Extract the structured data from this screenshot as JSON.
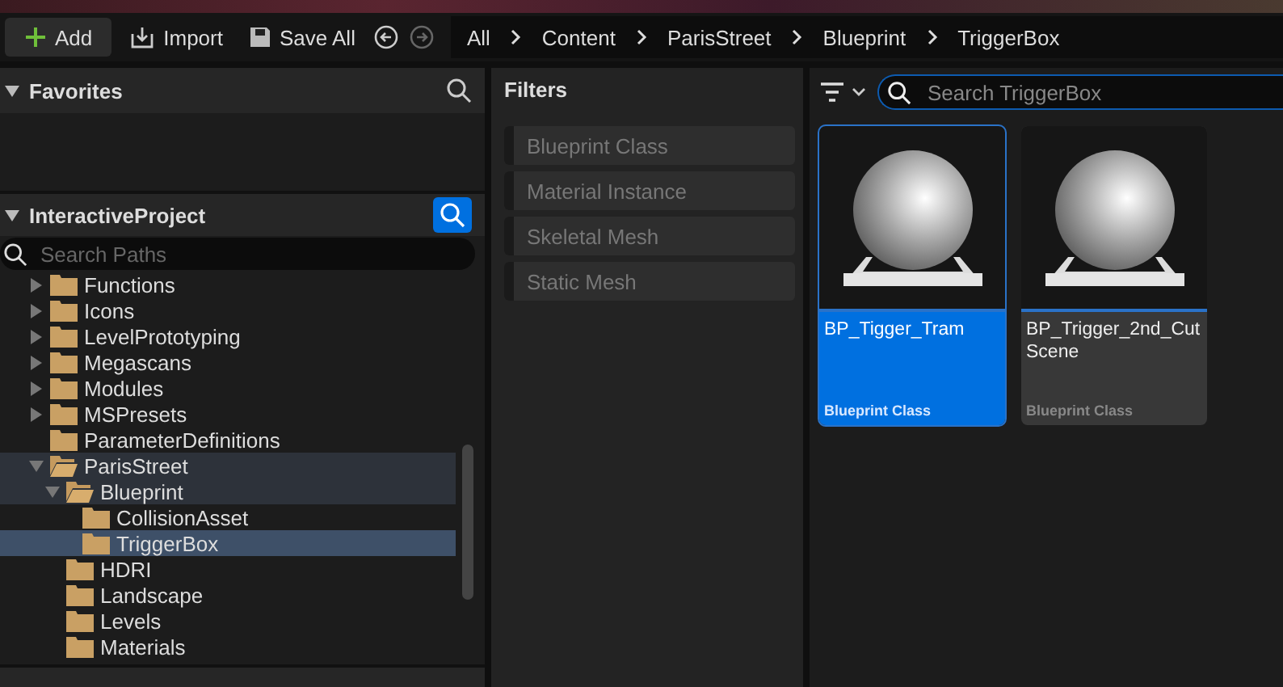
{
  "toolbar": {
    "add_button": "Add",
    "import_button": "Import",
    "save_all_button": "Save All",
    "breadcrumbs": [
      "All",
      "Content",
      "ParisStreet",
      "Blueprint",
      "TriggerBox"
    ]
  },
  "favorites": {
    "title": "Favorites"
  },
  "project": {
    "title": "InteractiveProject",
    "search": {
      "placeholder": "Search Paths"
    },
    "tree": [
      {
        "label": "Functions",
        "expanded": false,
        "has_children": true,
        "selected": false
      },
      {
        "label": "Icons",
        "expanded": false,
        "has_children": true,
        "selected": false
      },
      {
        "label": "LevelPrototyping",
        "expanded": false,
        "has_children": true,
        "selected": false
      },
      {
        "label": "Megascans",
        "expanded": false,
        "has_children": true,
        "selected": false
      },
      {
        "label": "Modules",
        "expanded": false,
        "has_children": true,
        "selected": false
      },
      {
        "label": "MSPresets",
        "expanded": false,
        "has_children": true,
        "selected": false
      },
      {
        "label": "ParameterDefinitions",
        "expanded": false,
        "has_children": false,
        "selected": false
      },
      {
        "label": "ParisStreet",
        "expanded": true,
        "has_children": true,
        "selected": false,
        "children": [
          {
            "label": "Blueprint",
            "expanded": true,
            "has_children": true,
            "selected": false,
            "children": [
              {
                "label": "CollisionAsset",
                "expanded": false,
                "has_children": false,
                "selected": false
              },
              {
                "label": "TriggerBox",
                "expanded": false,
                "has_children": false,
                "selected": true
              }
            ]
          },
          {
            "label": "HDRI",
            "expanded": false,
            "has_children": false,
            "selected": false
          },
          {
            "label": "Landscape",
            "expanded": false,
            "has_children": false,
            "selected": false
          },
          {
            "label": "Levels",
            "expanded": false,
            "has_children": false,
            "selected": false
          },
          {
            "label": "Materials",
            "expanded": false,
            "has_children": false,
            "selected": false
          }
        ]
      }
    ]
  },
  "filters": {
    "title": "Filters",
    "items": [
      {
        "label": "Blueprint Class",
        "checked": false
      },
      {
        "label": "Material Instance",
        "checked": false
      },
      {
        "label": "Skeletal Mesh",
        "checked": false
      },
      {
        "label": "Static Mesh",
        "checked": false
      }
    ]
  },
  "content": {
    "search": {
      "placeholder": "Search TriggerBox"
    },
    "assets": [
      {
        "name": "BP_Tigger_Tram",
        "type": "Blueprint Class",
        "selected": true
      },
      {
        "name": "BP_Trigger_2nd_Cut Scene",
        "type": "Blueprint Class",
        "selected": false
      }
    ]
  }
}
